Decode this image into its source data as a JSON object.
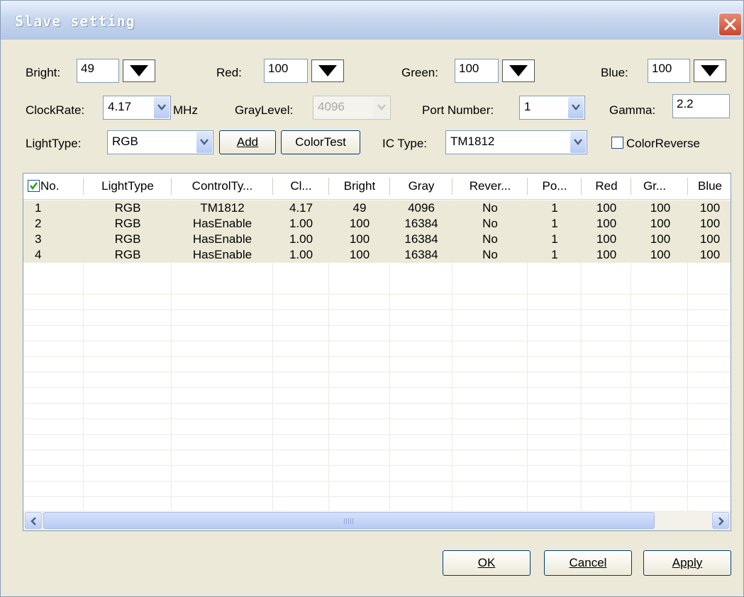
{
  "window": {
    "title": "Slave setting"
  },
  "controls": {
    "bright": {
      "label": "Bright:",
      "value": "49"
    },
    "red": {
      "label": "Red:",
      "value": "100"
    },
    "green": {
      "label": "Green:",
      "value": "100"
    },
    "blue": {
      "label": "Blue:",
      "value": "100"
    },
    "clockrate": {
      "label": "ClockRate:",
      "value": "4.17",
      "unit": "MHz"
    },
    "graylevel": {
      "label": "GrayLevel:",
      "value": "4096"
    },
    "port": {
      "label": "Port Number:",
      "value": "1"
    },
    "gamma": {
      "label": "Gamma:",
      "value": "2.2"
    },
    "lighttype": {
      "label": "LightType:",
      "value": "RGB"
    },
    "add_label": "Add",
    "colortest_label": "ColorTest",
    "ictype": {
      "label": "IC Type:",
      "value": "TM1812"
    },
    "colorreverse": {
      "label": "ColorReverse",
      "checked": false
    }
  },
  "table": {
    "columns": [
      "No.",
      "LightType",
      "ControlTy...",
      "Cl...",
      "Bright",
      "Gray",
      "Rever...",
      "Po...",
      "Red",
      "Gr...",
      "Blue"
    ],
    "select_all_checked": true,
    "rows": [
      [
        "1",
        "RGB",
        "TM1812",
        "4.17",
        "49",
        "4096",
        "No",
        "1",
        "100",
        "100",
        "100"
      ],
      [
        "2",
        "RGB",
        "HasEnable",
        "1.00",
        "100",
        "16384",
        "No",
        "1",
        "100",
        "100",
        "100"
      ],
      [
        "3",
        "RGB",
        "HasEnable",
        "1.00",
        "100",
        "16384",
        "No",
        "1",
        "100",
        "100",
        "100"
      ],
      [
        "4",
        "RGB",
        "HasEnable",
        "1.00",
        "100",
        "16384",
        "No",
        "1",
        "100",
        "100",
        "100"
      ]
    ]
  },
  "footer": {
    "ok": "OK",
    "cancel": "Cancel",
    "apply": "Apply"
  },
  "icons": {
    "close": "close-icon",
    "dropdown": "chevron-down-icon",
    "scroll_left": "arrow-left-icon",
    "scroll_right": "arrow-right-icon"
  }
}
